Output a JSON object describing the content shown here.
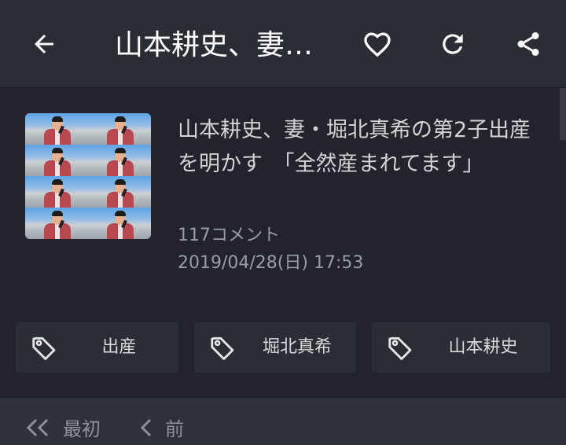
{
  "appbar": {
    "title": "山本耕史、妻…",
    "icons": {
      "back": "arrow-left-icon",
      "favorite": "heart-outline-icon",
      "reload": "refresh-icon",
      "share": "share-icon"
    }
  },
  "article": {
    "title": "山本耕史、妻・堀北真希の第2子出産を明かす　「全然産まれてます」",
    "comments": "117コメント",
    "date": "2019/04/28(日) 17:53"
  },
  "tags": [
    {
      "label": "出産",
      "icon": "tag-icon"
    },
    {
      "label": "堀北真希",
      "icon": "tag-icon"
    },
    {
      "label": "山本耕史",
      "icon": "tag-icon"
    }
  ],
  "pager": {
    "first_label": "最初",
    "prev_label": "前"
  },
  "colors": {
    "background": "#23242b",
    "appbar": "#2b2d35",
    "text": "#d2d3d6",
    "muted": "#9a9ca3"
  }
}
